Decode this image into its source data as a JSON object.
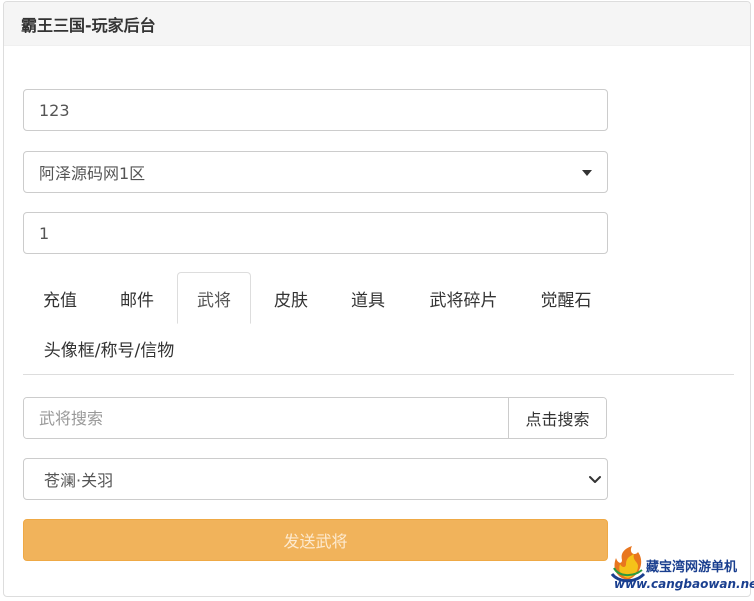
{
  "header": {
    "title": "霸王三国-玩家后台"
  },
  "form": {
    "account": {
      "value": "123"
    },
    "server": {
      "selected": "阿泽源码网1区"
    },
    "quantity": {
      "value": "1"
    }
  },
  "tabs": [
    {
      "label": "充值",
      "active": false
    },
    {
      "label": "邮件",
      "active": false
    },
    {
      "label": "武将",
      "active": true
    },
    {
      "label": "皮肤",
      "active": false
    },
    {
      "label": "道具",
      "active": false
    },
    {
      "label": "武将碎片",
      "active": false
    },
    {
      "label": "觉醒石",
      "active": false
    },
    {
      "label": "头像框/称号/信物",
      "active": false
    }
  ],
  "general_panel": {
    "search_placeholder": "武将搜索",
    "search_button": "点击搜索",
    "selected_general": "苍澜·关羽",
    "send_button": "发送武将"
  },
  "watermark": {
    "title": "藏宝湾网游单机",
    "url": "www.cangbaowan.net"
  },
  "colors": {
    "send_button": "#f0ad4e",
    "border": "#cccccc",
    "watermark": "#1a3f8f"
  }
}
